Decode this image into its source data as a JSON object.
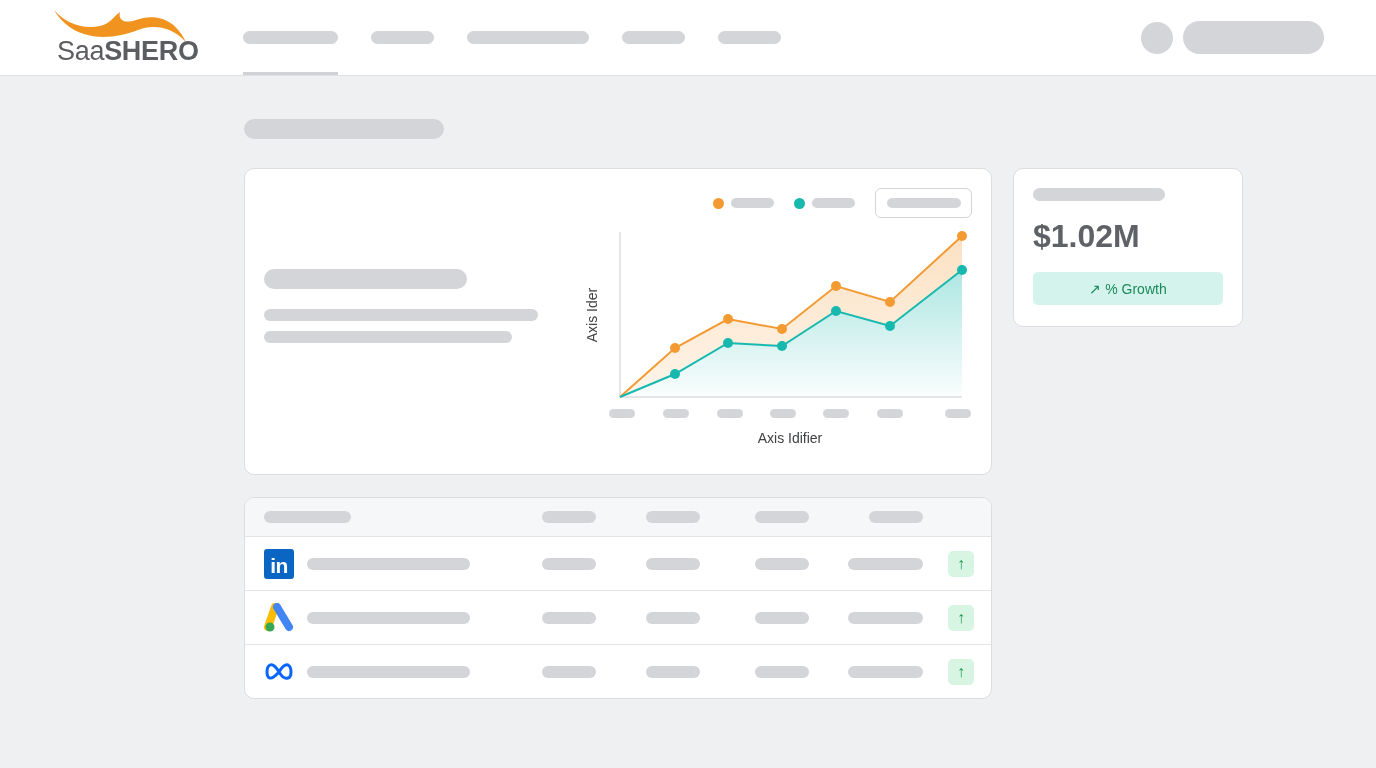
{
  "header": {
    "logo": "Saa**SHERO**",
    "nav": [
      {
        "selected": true
      },
      {
        "selected": false
      },
      {
        "selected": false
      },
      {
        "selected": false
      },
      {
        "selected": false
      }
    ]
  },
  "chart_card": {
    "legend": [
      {
        "color": "#f39a33"
      },
      {
        "color": "#17b8ae"
      }
    ],
    "y_axis_title": "Axis Ider",
    "x_axis_title": "Axis Idifier"
  },
  "stat_card": {
    "value": "$1.02M",
    "growth": "↗ % Growth"
  },
  "table": {
    "rows": [
      {
        "kind": "linkedin",
        "logo_text": "in",
        "trend": "↑"
      },
      {
        "kind": "ads",
        "trend": "↑"
      },
      {
        "kind": "meta",
        "trend": "↑"
      }
    ]
  }
}
